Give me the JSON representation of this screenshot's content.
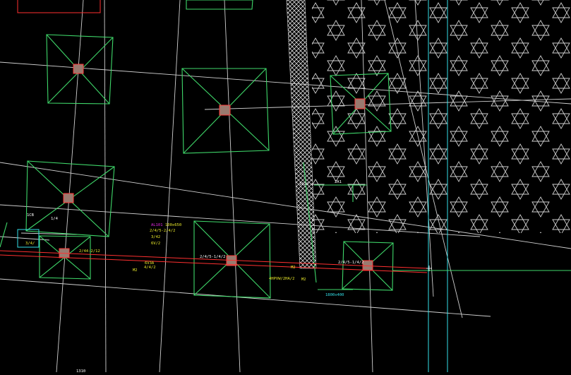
{
  "colors": {
    "background": "#000000",
    "grid_line": "#cfcfcf",
    "footing": "#3fd86a",
    "column_fill": "#9a7a6f",
    "column_stroke": "#ff3a3a",
    "pipe": "#ff3030",
    "hatch": "#d8d8d8",
    "stars": "#d0d0d0",
    "cyan": "#33e0e8",
    "label_yellow": "#e8e82a",
    "label_magenta": "#e02ae0",
    "label_white": "#ffffff",
    "label_cyan": "#33e0e8"
  },
  "labels": {
    "l01": "1CB",
    "l02": "1/4",
    "l03": "3/4/",
    "l04": "2/44-2/12",
    "l05": "M2",
    "l06": "4/4/2",
    "l07": "6V3A",
    "l08": "AL101",
    "l09": "100x650",
    "l10": "3/42",
    "l11": "6V/2",
    "l12": "2/4/5-2/4/2",
    "l13": "2/4/5-1/4/2",
    "l14": "4HPVW/2HA/2",
    "l15": "M2",
    "l16": "M2",
    "l17": "2/4/5-1/4/2",
    "l18": "1020",
    "l19": "2A1",
    "l20": "1800x400",
    "l21": "1310"
  }
}
